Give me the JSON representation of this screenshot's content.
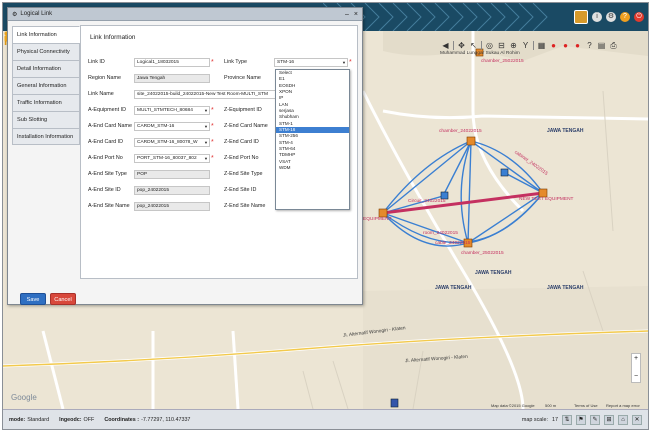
{
  "window": {
    "title": "Logical Link",
    "close_glyph": "×"
  },
  "tabs": [
    {
      "label": "Link Information",
      "active": true
    },
    {
      "label": "Physical Connectivity"
    },
    {
      "label": "Detail Information"
    },
    {
      "label": "General Information"
    },
    {
      "label": "Traffic Information"
    },
    {
      "label": "Sub Slotting"
    },
    {
      "label": "Installation Information"
    }
  ],
  "panel": {
    "heading": "Link Information",
    "left_fields": [
      {
        "label": "Link ID",
        "value": "Logical1_18032015",
        "required": true
      },
      {
        "label": "Region Name",
        "value": "Jawa Tengah",
        "readonly": true
      },
      {
        "label": "Link Name",
        "value": "site_24022015-build_24022015-New Test Room-MULTI_STM",
        "wide": true
      },
      {
        "label": "A-Equipment ID",
        "value": "MULTI_STMTECH_80684",
        "select": true,
        "required": true
      },
      {
        "label": "A-End Card Name",
        "value": "CARDM_STM-16",
        "select": true,
        "required": true
      },
      {
        "label": "A-End Card ID",
        "value": "CARDM_STM-16_80078_W",
        "select": true,
        "required": true
      },
      {
        "label": "A-End Port No",
        "value": "PORT_STM-16_80037_802",
        "select": true,
        "required": true
      },
      {
        "label": "A-End Site Type",
        "value": "POP",
        "readonly": true
      },
      {
        "label": "A-End Site ID",
        "value": "pop_24022015",
        "readonly": true
      },
      {
        "label": "A-End Site Name",
        "value": "pop_24022015",
        "readonly": true
      }
    ],
    "right_fields": [
      {
        "label": "Link Type",
        "value": "STM-16",
        "select": true,
        "required": true
      },
      {
        "label": "Province Name",
        "value": ""
      },
      {
        "label": "Z-Equipment ID",
        "value": ""
      },
      {
        "label": "Z-End Card Name",
        "value": ""
      },
      {
        "label": "Z-End Card ID",
        "value": ""
      },
      {
        "label": "Z-End Port No",
        "value": ""
      },
      {
        "label": "Z-End Site Type",
        "value": ""
      },
      {
        "label": "Z-End Site ID",
        "value": ""
      },
      {
        "label": "Z-End Site Name",
        "value": ""
      }
    ],
    "link_type_options": [
      "Select",
      "E1",
      "EOSDH",
      "XPON",
      "IP",
      "LAN",
      "serjasa",
      "Shubham",
      "STM-1",
      "STM-16",
      "STM-256",
      "STM-4",
      "STM-64",
      "TDMHP",
      "VSAT",
      "WDM"
    ],
    "link_type_selected_index": 9
  },
  "buttons": {
    "save": "Save",
    "cancel": "Cancel"
  },
  "map": {
    "labels": [
      {
        "text": "JAWA TENGAH"
      },
      {
        "text": "JAWA TENGAH"
      },
      {
        "text": "JAWA TENGAH"
      },
      {
        "text": "JAWA TENGAH"
      }
    ],
    "sites": [
      {
        "text": "chamber_24022015"
      },
      {
        "text": "cabinet_24022015"
      },
      {
        "text": "Circuit_24022015"
      },
      {
        "text": "room_24022015"
      },
      {
        "text": "cable_24022015"
      },
      {
        "text": "chamber_25022015"
      },
      {
        "text": "NEW TEST EQUIPMENT"
      },
      {
        "text": "EQUIPMENT"
      }
    ],
    "streets": [
      "Jl. Alternatif Wonogiri - Klaten",
      "Jl. Alternatif Wonogiri - Klaten"
    ],
    "credits": [
      "Map data ©2015 Google",
      "500 m",
      "Terms of Use",
      "Report a map error"
    ],
    "google": "Google",
    "place": "Muhammad Lunggar Sukau Al Rohim"
  },
  "status_bar": {
    "mode_label": "mode:",
    "mode_value": "Standard",
    "ingeodc_label": "Ingeodc:",
    "ingeodc_value": "OFF",
    "coord_label": "Coordinates :",
    "coord_value": "-7.77297, 110.47337",
    "scale_label": "map scale:",
    "scale_value": "17"
  },
  "colors": {
    "banner": "#1a4a64",
    "link_thick": "#c43060",
    "link_thin": "#3a7fd2",
    "save": "#2f6fc2",
    "cancel": "#d8483b",
    "highlight": "#3d7fd1"
  }
}
